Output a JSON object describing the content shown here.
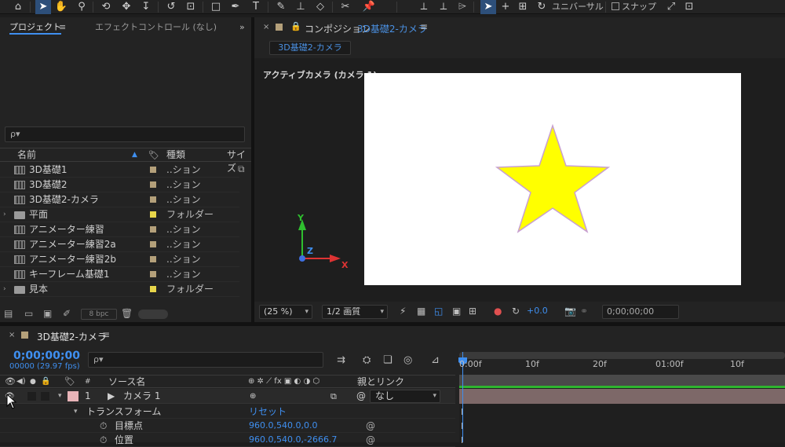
{
  "toolbar": {
    "universal_label": "ユニバーサル",
    "snap_label": "スナップ",
    "icons": [
      "home-icon",
      "selection-tool-icon",
      "hand-tool-icon",
      "zoom-tool-icon",
      "orbit-camera-icon",
      "pan-camera-icon",
      "dolly-camera-icon",
      "rotate-tool-icon",
      "pan-behind-icon",
      "rectangle-tool-icon",
      "pen-tool-icon",
      "type-tool-icon",
      "brush-tool-icon",
      "clone-stamp-icon",
      "eraser-icon",
      "roto-brush-icon",
      "puppet-pin-icon"
    ]
  },
  "project_panel": {
    "tab_project": "プロジェクト",
    "tab_effect_controls": "エフェクトコントロール (なし)",
    "search_placeholder": "ρ▾",
    "columns": {
      "name": "名前",
      "type": "種類",
      "size": "サイズ"
    },
    "items": [
      {
        "name": "3D基礎1",
        "kind": "..ション",
        "icon": "composition-icon",
        "label_color": "#b4a07a",
        "expandable": false
      },
      {
        "name": "3D基礎2",
        "kind": "..ション",
        "icon": "composition-icon",
        "label_color": "#b4a07a",
        "expandable": false
      },
      {
        "name": "3D基礎2-カメラ",
        "kind": "..ション",
        "icon": "composition-icon",
        "label_color": "#b4a07a",
        "expandable": false
      },
      {
        "name": "平面",
        "kind": "フォルダー",
        "icon": "folder-icon",
        "label_color": "#e8d64a",
        "expandable": true
      },
      {
        "name": "アニメーター練習",
        "kind": "..ション",
        "icon": "composition-icon",
        "label_color": "#b4a07a",
        "expandable": false
      },
      {
        "name": "アニメーター練習2a",
        "kind": "..ション",
        "icon": "composition-icon",
        "label_color": "#b4a07a",
        "expandable": false
      },
      {
        "name": "アニメーター練習2b",
        "kind": "..ション",
        "icon": "composition-icon",
        "label_color": "#b4a07a",
        "expandable": false
      },
      {
        "name": "キーフレーム基礎1",
        "kind": "..ション",
        "icon": "composition-icon",
        "label_color": "#b4a07a",
        "expandable": false
      },
      {
        "name": "見本",
        "kind": "フォルダー",
        "icon": "folder-icon",
        "label_color": "#e8d64a",
        "expandable": true
      }
    ],
    "bpc": "8 bpc"
  },
  "composition_panel": {
    "tab_prefix": "コンポジション",
    "comp_name": "3D基礎2-カメラ",
    "flowchart_label": "3D基礎2-カメラ",
    "view_label": "アクティブカメラ (カメラ 1)",
    "axis": {
      "y": "Y",
      "z": "Z",
      "x": "X"
    },
    "zoom": "(25 %)",
    "resolution": "1/2 画質",
    "exposure": "+0.0",
    "timecode": "0;00;00;00",
    "star_fill": "#ffff00",
    "star_stroke": "#c8a0d0"
  },
  "timeline": {
    "tab_label": "3D基礎2-カメラ",
    "timecode": "0;00;00;00",
    "fps": "00000 (29.97 fps)",
    "search_placeholder": "ρ▾",
    "headers": {
      "num": "#",
      "source": "ソース名",
      "parent": "親とリンク"
    },
    "ruler_ticks": [
      "0:00f",
      "10f",
      "20f",
      "01:00f",
      "10f"
    ],
    "layer": {
      "num": "1",
      "name": "カメラ 1",
      "parent": "なし",
      "label_color": "#e8b4b8"
    },
    "transform": {
      "label": "トランスフォーム",
      "reset": "リセット"
    },
    "properties": [
      {
        "name": "目標点",
        "value": "960.0,540.0,0.0"
      },
      {
        "name": "位置",
        "value": "960.0,540.0,-2666.7"
      }
    ]
  }
}
